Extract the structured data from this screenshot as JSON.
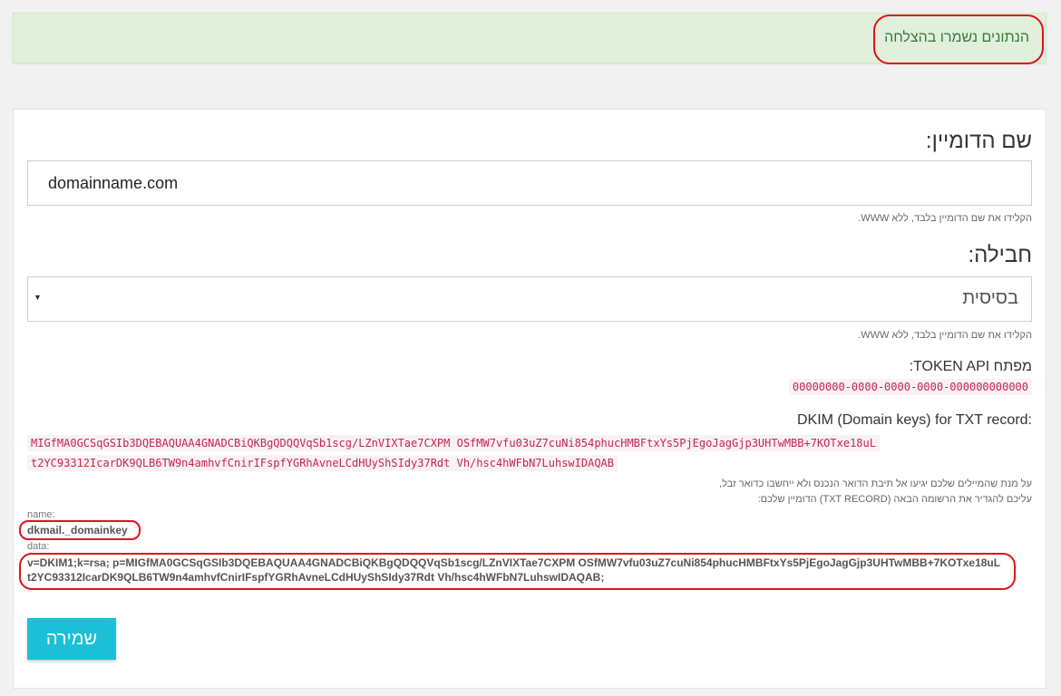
{
  "alert": {
    "message": "הנתונים נשמרו בהצלחה"
  },
  "form": {
    "domain_label": "שם הדומיין:",
    "domain_value": "domainname.com",
    "domain_help": "הקלידו את שם הדומיין בלבד, ללא WWW.",
    "package_label": "חבילה:",
    "package_value": "בסיסית",
    "package_help": "הקלידו את שם הדומיין בלבד, ללא WWW.",
    "token_label": "מפתח TOKEN API:",
    "token_value": "00000000-0000-0000-0000-000000000000",
    "dkim_label": "DKIM (Domain keys) for TXT record:",
    "dkim_line1": "MIGfMA0GCSqGSIb3DQEBAQUAA4GNADCBiQKBgQDQQVqSb1scg/LZnVIXTae7CXPM OSfMW7vfu03uZ7cuNi854phucHMBFtxYs5PjEgoJagGjp3UHTwMBB+7KOTxe18uL",
    "dkim_line2": "t2YC93312IcarDK9QLB6TW9n4amhvfCnirIFspfYGRhAvneLCdHUyShSIdy37Rdt Vh/hsc4hWFbN7LuhswIDAQAB",
    "instructions_line1": "על מנת שהמיילים שלכם יגיעו אל תיבת הדואר הנכנס ולא ייחשבו כדואר זבל,",
    "instructions_line2": "עליכם להגדיר את הרשומה הבאה (TXT RECORD) הדומיין שלכם:",
    "name_label": "name:",
    "name_value": "dkmail._domainkey",
    "data_label": "data:",
    "data_line1": "v=DKIM1;k=rsa; p=MIGfMA0GCSqGSIb3DQEBAQUAA4GNADCBiQKBgQDQQVqSb1scg/LZnVIXTae7CXPM OSfMW7vfu03uZ7cuNi854phucHMBFtxYs5PjEgoJagGjp3UHTwMBB+7KOTxe18uL",
    "data_line2": "t2YC93312IcarDK9QLB6TW9n4amhvfCnirIFspfYGRhAvneLCdHUyShSIdy37Rdt Vh/hsc4hWFbN7LuhswIDAQAB;",
    "save_label": "שמירה"
  },
  "colors": {
    "accent": "#1cbfd6",
    "success_bg": "#e1f0da",
    "annotation": "#e0101f",
    "code": "#c7254e"
  }
}
